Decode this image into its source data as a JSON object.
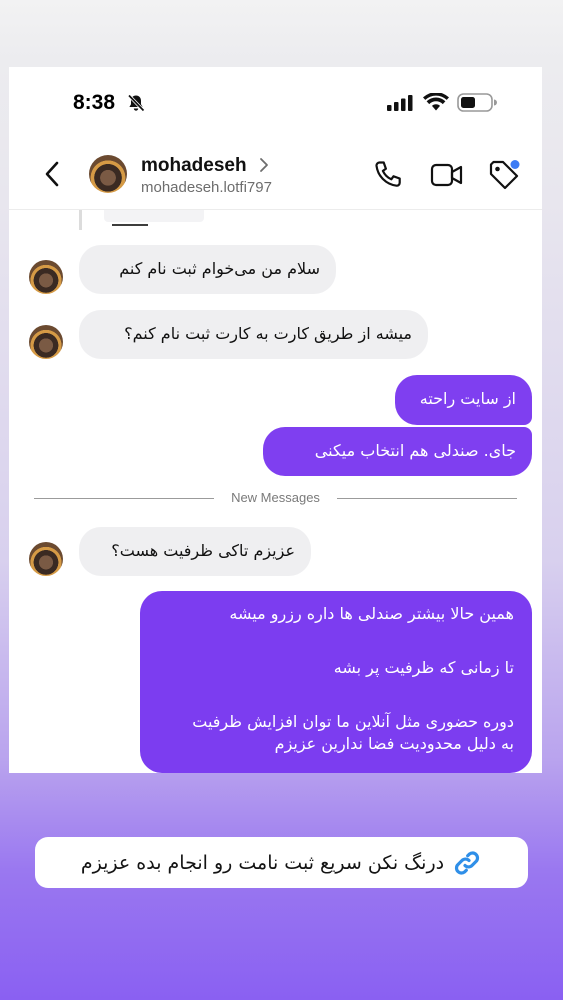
{
  "status_bar": {
    "time": "8:38"
  },
  "header": {
    "name": "mohadeseh",
    "handle": "mohadeseh.lotfi797"
  },
  "messages": [
    {
      "direction": "incoming",
      "text": "سلام من می‌خوام ثبت نام کنم"
    },
    {
      "direction": "incoming",
      "text": "میشه از طریق کارت به کارت ثبت نام کنم؟"
    },
    {
      "direction": "outgoing",
      "text": "از سایت راحته"
    },
    {
      "direction": "outgoing",
      "text": "جای. صندلی هم انتخاب میکنی"
    },
    {
      "direction": "incoming",
      "text": "عزیزم تاکی ظرفیت هست؟"
    }
  ],
  "separator": {
    "label": "New Messages"
  },
  "last_message": {
    "line1": "همین حالا بیشتر صندلی ها داره رزرو میشه",
    "line2": "تا زمانی که ظرفیت پر بشه",
    "line3": "دوره حضوری مثل آنلاین ما توان افزایش ظرفیت",
    "line4": "به دلیل محدودیت فضا ندارین عزیزم"
  },
  "link_sticker": {
    "text": "درنگ نکن سریع ثبت نامت رو انجام بده عزیزم"
  },
  "colors": {
    "outgoing_bubble": "#7f3ff0",
    "incoming_bubble": "#efeff1",
    "link_icon": "#2f8fe8",
    "notification_dot": "#3d7cf5"
  }
}
